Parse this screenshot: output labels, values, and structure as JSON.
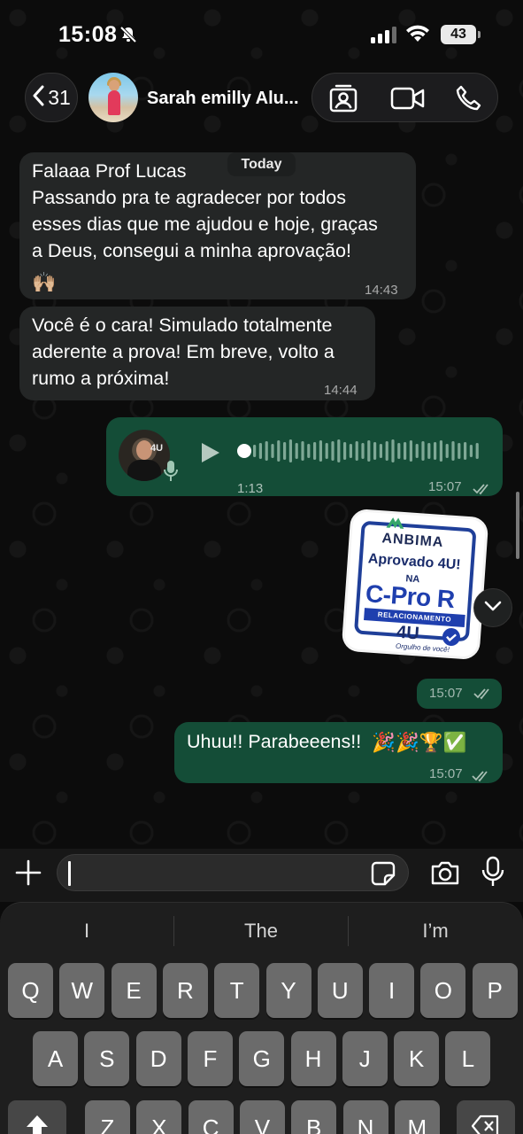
{
  "status_bar": {
    "time": "15:08",
    "battery": "43"
  },
  "header": {
    "back_count": "31",
    "contact_name": "Sarah emilly Alu..."
  },
  "date_pill": "Today",
  "messages": [
    {
      "text": "Falaaa Prof Lucas\nPassando pra te agradecer por todos\nesses dias que me ajudou e hoje, graças\na Deus, consegui a minha aprovação!",
      "emoji": "🙌🏼",
      "time": "14:43"
    },
    {
      "text": "Você é o cara! Simulado totalmente\naderente a prova! Em breve, volto a\nrumo a próxima!",
      "time": "14:44"
    }
  ],
  "voice_message": {
    "avatar_label": "4U",
    "duration": "1:13",
    "time": "15:07"
  },
  "sticker": {
    "brand": "ANBIMA",
    "line1": "Aprovado 4U!",
    "line2": "NA",
    "line3": "C-Pro R",
    "line4": "RELACIONAMENTO",
    "line5": "4U",
    "line6": "Orgulho de você!",
    "time": "15:07"
  },
  "outgoing_text": {
    "text": "Uhuu!! Parabeeens!!",
    "emojis": "🎉🎉🏆✅",
    "time": "15:07"
  },
  "keyboard": {
    "suggestions": [
      "I",
      "The",
      "I’m"
    ],
    "row1": [
      "Q",
      "W",
      "E",
      "R",
      "T",
      "Y",
      "U",
      "I",
      "O",
      "P"
    ],
    "row2": [
      "A",
      "S",
      "D",
      "F",
      "G",
      "H",
      "J",
      "K",
      "L"
    ],
    "row3": [
      "Z",
      "X",
      "C",
      "V",
      "B",
      "N",
      "M"
    ]
  },
  "colors": {
    "incoming_bubble": "#242626",
    "outgoing_bubble": "#144d37",
    "background": "#0b0b0b"
  }
}
